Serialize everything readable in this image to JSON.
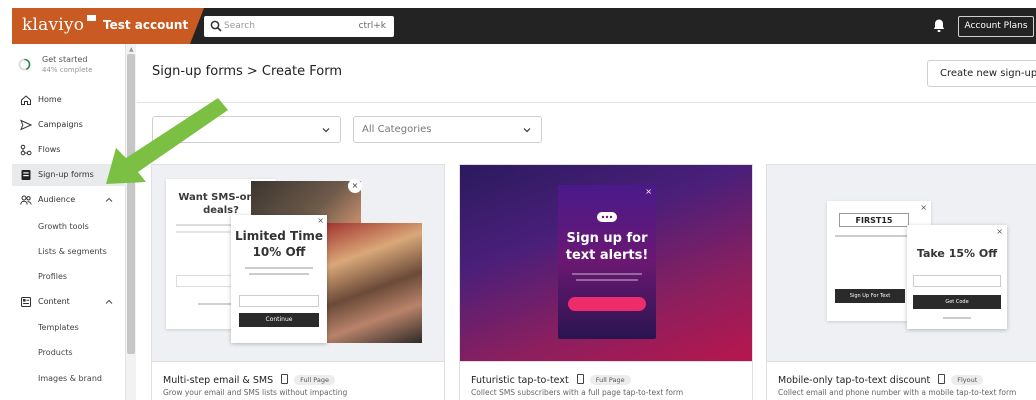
{
  "topbar": {
    "logo": "klaviyo",
    "account": "Test account",
    "search_placeholder": "Search",
    "search_shortcut": "ctrl+k",
    "account_plans": "Account Plans"
  },
  "sidebar": {
    "get_started": {
      "title": "Get started",
      "progress": "44% complete",
      "progress_value": 0.44
    },
    "items": [
      {
        "label": "Home"
      },
      {
        "label": "Campaigns"
      },
      {
        "label": "Flows"
      },
      {
        "label": "Sign-up forms"
      },
      {
        "label": "Audience"
      },
      {
        "label": "Content"
      }
    ],
    "audience_children": [
      "Growth tools",
      "Lists & segments",
      "Profiles"
    ],
    "content_children": [
      "Templates",
      "Products",
      "Images & brand"
    ]
  },
  "main": {
    "breadcrumb": "Sign-up forms > Create Form",
    "create_button": "Create new sign-up fo",
    "filter_all_categories": "All Categories"
  },
  "cards": [
    {
      "title": "Multi-step email & SMS",
      "badge": "Full Page",
      "description": "Grow your email and SMS lists without impacting",
      "preview": {
        "headline": "Want SMS-only deals?",
        "offer_line1": "Limited Time",
        "offer_line2": "10% Off",
        "button": "Continue"
      }
    },
    {
      "title": "Futuristic tap-to-text",
      "badge": "Full Page",
      "description": "Collect SMS subscribers with a full page tap-to-text form",
      "preview": {
        "headline_line1": "Sign up for",
        "headline_line2": "text alerts!"
      }
    },
    {
      "title": "Mobile-only tap-to-text discount",
      "badge": "Flyout",
      "description": "Collect email and phone number with a mobile tap-to-text form",
      "preview": {
        "code": "FIRST15",
        "headline": "Take 15% Off",
        "sign_up_button": "Sign Up For Text",
        "get_code_button": "Get Code"
      }
    }
  ],
  "colors": {
    "topbar": "#232323",
    "brand": "#c85a22",
    "arrow": "#7bc043",
    "card2_bg_from": "#3a1d6e",
    "card2_bg_to": "#c2185b"
  }
}
